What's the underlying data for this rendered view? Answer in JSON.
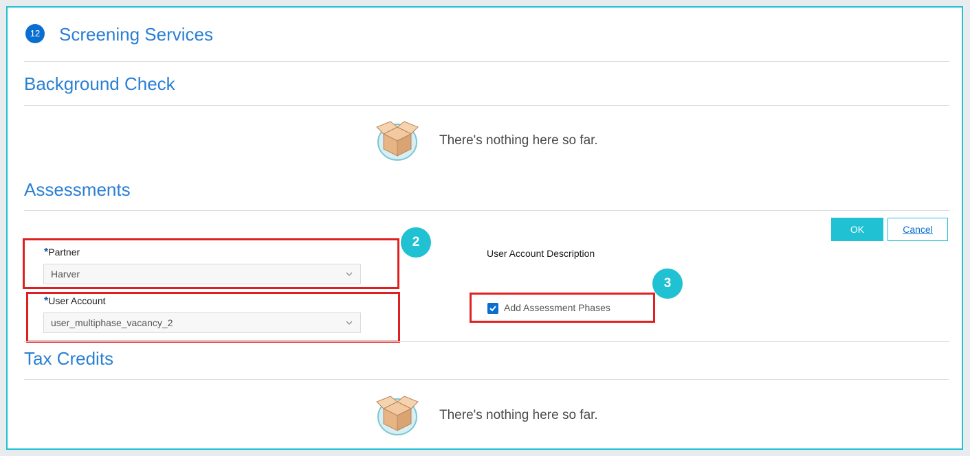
{
  "section": {
    "step": "12",
    "title": "Screening Services"
  },
  "background_check": {
    "title": "Background Check",
    "empty_text": "There's nothing here so far."
  },
  "assessments": {
    "title": "Assessments",
    "ok_label": "OK",
    "cancel_label": "Cancel",
    "partner": {
      "required_mark": "*",
      "label": "Partner",
      "value": "Harver"
    },
    "user_account": {
      "required_mark": "*",
      "label": "User Account",
      "value": "user_multiphase_vacancy_2"
    },
    "user_account_description_label": "User Account Description",
    "add_phases": {
      "label": "Add Assessment Phases",
      "checked": true
    }
  },
  "tax_credits": {
    "title": "Tax Credits",
    "empty_text": "There's nothing here so far."
  },
  "callouts": {
    "badge_2": "2",
    "badge_3": "3"
  },
  "colors": {
    "accent": "#1fc1d2",
    "heading": "#2a7fd4",
    "highlight": "#e02020",
    "primary": "#0a6ed1"
  }
}
